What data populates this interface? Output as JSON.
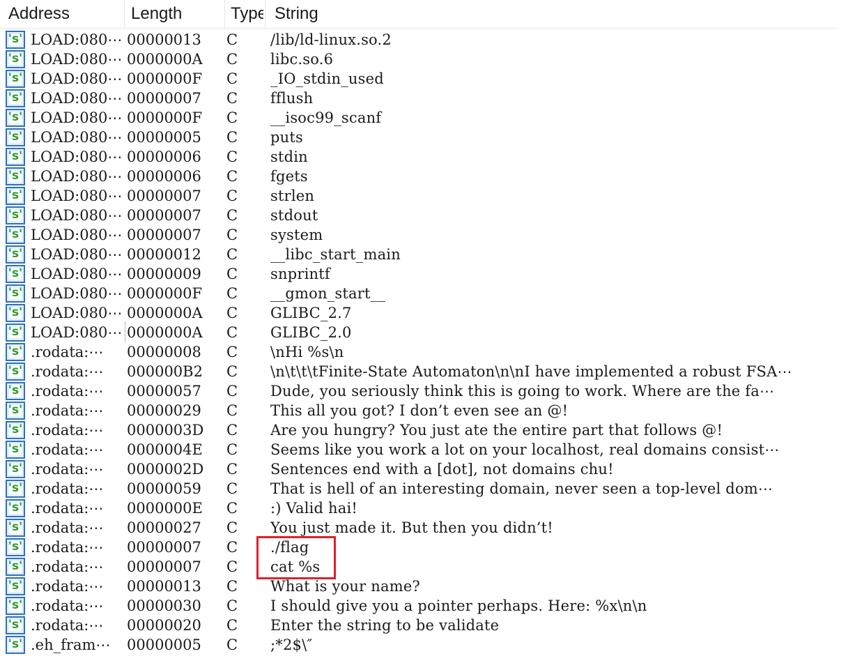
{
  "columns": {
    "address": "Address",
    "length": "Length",
    "type": "Type",
    "string": "String"
  },
  "icon_glyph": "'s'",
  "rows": [
    {
      "address": "LOAD:080⋯",
      "length": "00000013",
      "type": "C",
      "string": "/lib/ld-linux.so.2"
    },
    {
      "address": "LOAD:080⋯",
      "length": "0000000A",
      "type": "C",
      "string": "libc.so.6"
    },
    {
      "address": "LOAD:080⋯",
      "length": "0000000F",
      "type": "C",
      "string": "_IO_stdin_used"
    },
    {
      "address": "LOAD:080⋯",
      "length": "00000007",
      "type": "C",
      "string": "fflush"
    },
    {
      "address": "LOAD:080⋯",
      "length": "0000000F",
      "type": "C",
      "string": "__isoc99_scanf"
    },
    {
      "address": "LOAD:080⋯",
      "length": "00000005",
      "type": "C",
      "string": "puts"
    },
    {
      "address": "LOAD:080⋯",
      "length": "00000006",
      "type": "C",
      "string": "stdin"
    },
    {
      "address": "LOAD:080⋯",
      "length": "00000006",
      "type": "C",
      "string": "fgets"
    },
    {
      "address": "LOAD:080⋯",
      "length": "00000007",
      "type": "C",
      "string": "strlen"
    },
    {
      "address": "LOAD:080⋯",
      "length": "00000007",
      "type": "C",
      "string": "stdout"
    },
    {
      "address": "LOAD:080⋯",
      "length": "00000007",
      "type": "C",
      "string": "system"
    },
    {
      "address": "LOAD:080⋯",
      "length": "00000012",
      "type": "C",
      "string": "__libc_start_main"
    },
    {
      "address": "LOAD:080⋯",
      "length": "00000009",
      "type": "C",
      "string": "snprintf"
    },
    {
      "address": "LOAD:080⋯",
      "length": "0000000F",
      "type": "C",
      "string": "__gmon_start__"
    },
    {
      "address": "LOAD:080⋯",
      "length": "0000000A",
      "type": "C",
      "string": "GLIBC_2.7"
    },
    {
      "address": "LOAD:080⋯",
      "length": "0000000A",
      "type": "C",
      "string": "GLIBC_2.0"
    },
    {
      "address": ".rodata:⋯",
      "length": "00000008",
      "type": "C",
      "string": "\\nHi %s\\n"
    },
    {
      "address": ".rodata:⋯",
      "length": "000000B2",
      "type": "C",
      "string": "\\n\\t\\t\\tFinite-State Automaton\\n\\nI have implemented a robust FSA⋯"
    },
    {
      "address": ".rodata:⋯",
      "length": "00000057",
      "type": "C",
      "string": "Dude, you seriously think this is going to work. Where are the fa⋯"
    },
    {
      "address": ".rodata:⋯",
      "length": "00000029",
      "type": "C",
      "string": "This all you got? I don’t even see an @!"
    },
    {
      "address": ".rodata:⋯",
      "length": "0000003D",
      "type": "C",
      "string": "Are you hungry? You just ate the entire part that follows @!"
    },
    {
      "address": ".rodata:⋯",
      "length": "0000004E",
      "type": "C",
      "string": "Seems like you work a lot on your localhost, real domains consist⋯"
    },
    {
      "address": ".rodata:⋯",
      "length": "0000002D",
      "type": "C",
      "string": "Sentences end with a [dot], not domains chu!"
    },
    {
      "address": ".rodata:⋯",
      "length": "00000059",
      "type": "C",
      "string": "That is hell of an interesting domain, never seen a top-level dom⋯"
    },
    {
      "address": ".rodata:⋯",
      "length": "0000000E",
      "type": "C",
      "string": ":) Valid hai!"
    },
    {
      "address": ".rodata:⋯",
      "length": "00000027",
      "type": "C",
      "string": "You just made it. But then you didn’t!"
    },
    {
      "address": ".rodata:⋯",
      "length": "00000007",
      "type": "C",
      "string": "./flag"
    },
    {
      "address": ".rodata:⋯",
      "length": "00000007",
      "type": "C",
      "string": "cat %s"
    },
    {
      "address": ".rodata:⋯",
      "length": "00000013",
      "type": "C",
      "string": "What is your name?"
    },
    {
      "address": ".rodata:⋯",
      "length": "00000030",
      "type": "C",
      "string": "I should give you a pointer perhaps. Here: %x\\n\\n"
    },
    {
      "address": ".rodata:⋯",
      "length": "00000020",
      "type": "C",
      "string": "Enter the string to be validate"
    },
    {
      "address": ".eh_fram⋯",
      "length": "00000005",
      "type": "C",
      "string": ";*2$\\″"
    }
  ],
  "highlight_color": "#e0202a",
  "icon_color": "#2f6fbf",
  "icon_glyph_color": "#2a9d2a"
}
